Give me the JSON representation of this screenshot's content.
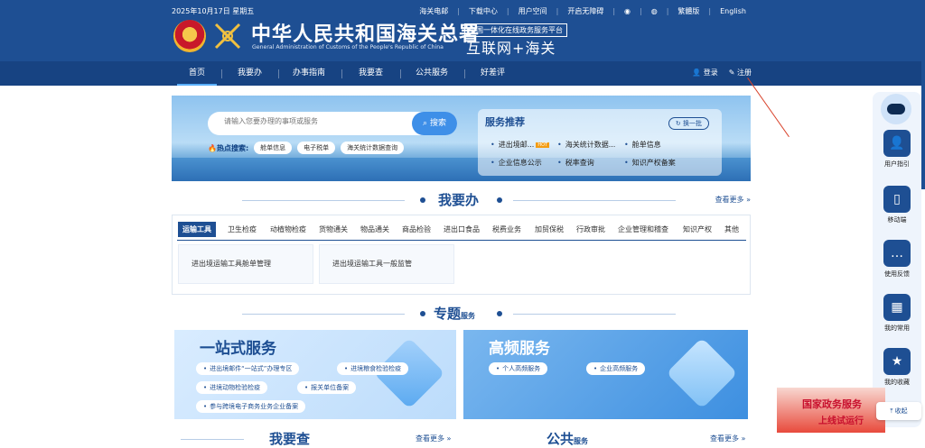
{
  "top": {
    "date": "2025年10月17日 星期五",
    "links": [
      "海关电邮",
      "下载中心",
      "用户空间",
      "开启无障碍",
      "繁體版",
      "English"
    ]
  },
  "header": {
    "title_cn": "中华人民共和国海关总署",
    "title_en": "General Administration of Customs of the People's Republic of China",
    "platform_small": "全国一体化在线政务服务平台",
    "platform_big": "互联网+海关"
  },
  "nav": {
    "items": [
      "首页",
      "我要办",
      "办事指南",
      "我要查",
      "公共服务",
      "好差评"
    ],
    "login": "登录",
    "register": "注册"
  },
  "hero": {
    "search_placeholder": "请输入您要办理的事项或服务",
    "search_button": "搜索",
    "hot_label": "热点搜索:",
    "hot_tags": [
      "舱单信息",
      "电子税单",
      "海关统计数据查询"
    ],
    "rec_title": "服务推荐",
    "rec_refresh": "换一批",
    "rec_items": [
      "进出境邮...",
      "海关统计数据...",
      "舱单信息",
      "企业信息公示",
      "税率查询",
      "知识产权备案"
    ],
    "hot_badge": "HOT"
  },
  "section_woyaoban": {
    "title": "我要办",
    "more": "查看更多 »",
    "tabs": [
      "运输工具",
      "卫生检疫",
      "动植物检疫",
      "货物通关",
      "物品通关",
      "商品检验",
      "进出口食品",
      "税费业务",
      "加贸保税",
      "行政审批",
      "企业管理和稽查",
      "知识产权",
      "其他"
    ],
    "cards": [
      "进出境运输工具舱单管理",
      "进出境运输工具一般监管"
    ]
  },
  "section_zhuanti": {
    "title": "专题",
    "sub": "服务"
  },
  "topic_a": {
    "title": "一站式服务",
    "pills": [
      "进出境邮件“一站式”办理专区",
      "进境粮食检验检疫",
      "进境动物检验检疫",
      "报关单位备案",
      "参与跨境电子商务业务企业备案"
    ]
  },
  "topic_b": {
    "title": "高频服务",
    "pills": [
      "个人高频服务",
      "企业高频服务"
    ]
  },
  "sidebar": {
    "items": [
      "用户指引",
      "移动端",
      "使用反馈",
      "我的常用",
      "我的收藏"
    ],
    "collapse": "收起"
  },
  "banner": {
    "line1": "国家政务服务",
    "line2": "上线试运行"
  },
  "bottom": {
    "left_title": "我要查",
    "right_title": "公共",
    "right_sub": "服务",
    "more": "查看更多 »"
  },
  "colors": {
    "brand": "#1e4f93",
    "nav": "#174382",
    "accent": "#3e8fe8"
  }
}
